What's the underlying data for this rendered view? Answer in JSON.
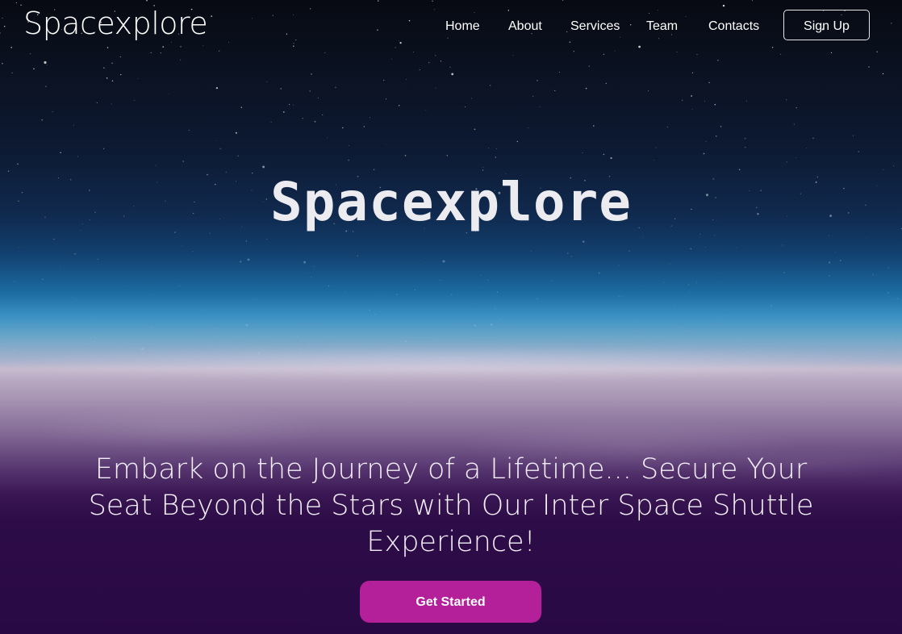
{
  "navbar": {
    "brand": "Spacexplore",
    "links": [
      {
        "label": "Home"
      },
      {
        "label": "About"
      },
      {
        "label": "Services"
      },
      {
        "label": "Team"
      },
      {
        "label": "Contacts"
      }
    ],
    "signup_label": "Sign Up"
  },
  "hero": {
    "title": "Spacexplore",
    "tagline": "Embark on the Journey of a Lifetime... Secure Your Seat Beyond the Stars with Our Inter Space Shuttle Experience!",
    "cta_label": "Get Started"
  },
  "colors": {
    "cta_background": "#b3209a",
    "page_bottom": "#290943",
    "sky_top": "#070a12",
    "horizon_blue": "#1b6aa0"
  }
}
